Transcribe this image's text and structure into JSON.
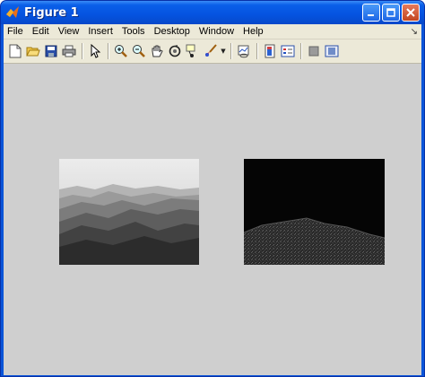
{
  "window": {
    "title": "Figure 1",
    "title_color": "#ffffff",
    "titlebar_color": "#0553e0"
  },
  "menu": {
    "items": [
      "File",
      "Edit",
      "View",
      "Insert",
      "Tools",
      "Desktop",
      "Window",
      "Help"
    ]
  },
  "toolbar": {
    "buttons": [
      "new-figure-icon",
      "open-file-icon",
      "save-icon",
      "print-icon",
      "edit-plot-arrow-icon",
      "zoom-in-icon",
      "zoom-out-icon",
      "pan-hand-icon",
      "rotate-3d-icon",
      "data-cursor-icon",
      "brush-icon",
      "link-plot-icon",
      "colorbar-icon",
      "legend-icon",
      "hide-plot-tools-icon",
      "show-plot-tools-icon"
    ]
  },
  "figure": {
    "background": "#cfcfcf",
    "images": [
      {
        "name": "mountains-grayscale-image",
        "description_color": "#8a8a8a"
      },
      {
        "name": "mountains-dark-processed-image",
        "description_color": "#050505"
      }
    ]
  }
}
